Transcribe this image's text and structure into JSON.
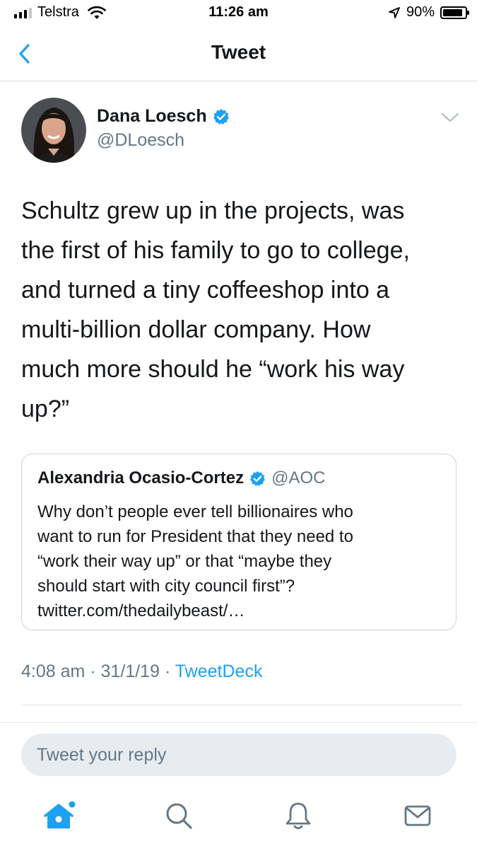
{
  "status_bar": {
    "carrier": "Telstra",
    "time": "11:26 am",
    "battery_percent": "90%",
    "battery_level": 0.9,
    "icons": [
      "signal-icon",
      "wifi-icon",
      "location-icon",
      "battery-icon"
    ]
  },
  "nav": {
    "title": "Tweet",
    "back_icon": "chevron-left-icon"
  },
  "tweet": {
    "author_name": "Dana Loesch",
    "author_handle": "@DLoesch",
    "verified": true,
    "text_lines": [
      "Schultz grew up in the projects, was",
      "the first of his family to go to college,",
      "and turned a tiny coffeeshop into a",
      "multi-billion dollar company. How",
      "much more should he “work his way",
      "up?”"
    ],
    "time": "4:08 am",
    "date": "31/1/19",
    "separator": "·",
    "source": "TweetDeck"
  },
  "quoted_tweet": {
    "author_name": "Alexandria Ocasio-Cortez",
    "author_handle": "@AOC",
    "verified": true,
    "text_lines": [
      "Why don’t people ever tell billionaires who",
      "want to run for President that they need to",
      "“work their way up” or that “maybe they",
      "should start with city council first”?",
      "twitter.com/thedailybeast/…"
    ]
  },
  "reply": {
    "placeholder": "Tweet your reply"
  },
  "tab_bar": {
    "items": [
      "home-icon",
      "search-icon",
      "notifications-icon",
      "messages-icon"
    ],
    "active": "home-icon"
  },
  "colors": {
    "accent": "#1da1f2",
    "secondary_text": "#657786",
    "border": "#ccd6dd",
    "reply_bg": "#e6ecf0"
  }
}
